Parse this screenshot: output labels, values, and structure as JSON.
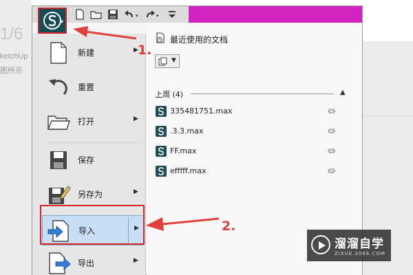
{
  "background": {
    "slide_number": "1/6",
    "text_line1": "ketchUp",
    "text_line2": "图所示"
  },
  "quick_access": [
    {
      "name": "new-file-icon"
    },
    {
      "name": "open-folder-icon"
    },
    {
      "name": "save-disk-icon"
    },
    {
      "name": "undo-icon"
    },
    {
      "name": "redo-icon"
    },
    {
      "name": "customize-dropdown-icon"
    }
  ],
  "menu": {
    "new_label": "新建",
    "reset_label": "重置",
    "open_label": "打开",
    "save_label": "保存",
    "save_as_label": "另存为",
    "import_label": "导入",
    "export_label": "导出",
    "submenu_arrow": "▶"
  },
  "recent": {
    "title": "最近使用的文档",
    "group_label": "上周 (4)",
    "group_chevron": "▲",
    "view_arrow": "▼",
    "files": [
      {
        "name": "335481751.max"
      },
      {
        "name": ".3.3.max"
      },
      {
        "name": "FF.max"
      },
      {
        "name": "efffff.max"
      }
    ]
  },
  "annotations": {
    "step1": "1.",
    "step2": "2."
  },
  "watermark": {
    "title": "溜溜自学",
    "subtitle": "ZIXUE.3066.COM"
  },
  "colors": {
    "annotation_red": "#d4262a",
    "title_purple": "#d223c0",
    "logo_teal": "#164d55",
    "highlight_blue": "#c8def5"
  }
}
